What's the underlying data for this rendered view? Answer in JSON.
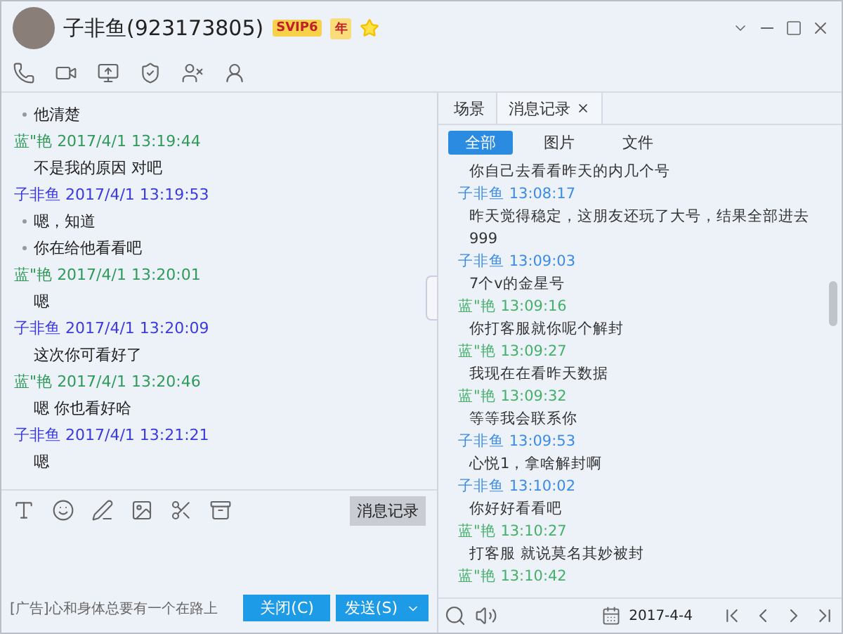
{
  "window": {
    "title": "子非鱼(923173805)",
    "badges": [
      {
        "kind": "vip",
        "label": "SVIP6"
      },
      {
        "kind": "year",
        "label": "年"
      }
    ]
  },
  "chat": [
    {
      "kind": "text",
      "text": "他清楚",
      "bullet": true
    },
    {
      "kind": "meta",
      "sender": "蓝\"艳",
      "time": "2017/4/1 13:19:44",
      "color": "#2f9a5a"
    },
    {
      "kind": "text",
      "text": "不是我的原因 对吧",
      "bullet": false
    },
    {
      "kind": "meta",
      "sender": "子非鱼",
      "time": "2017/4/1 13:19:53",
      "color": "#3a3ae0"
    },
    {
      "kind": "text",
      "text": "嗯，知道",
      "bullet": true
    },
    {
      "kind": "text",
      "text": "你在给他看看吧",
      "bullet": true
    },
    {
      "kind": "meta",
      "sender": "蓝\"艳",
      "time": "2017/4/1 13:20:01",
      "color": "#2f9a5a"
    },
    {
      "kind": "text",
      "text": "嗯",
      "bullet": false
    },
    {
      "kind": "meta",
      "sender": "子非鱼",
      "time": "2017/4/1 13:20:09",
      "color": "#3a3ae0"
    },
    {
      "kind": "text",
      "text": "这次你可看好了",
      "bullet": false
    },
    {
      "kind": "meta",
      "sender": "蓝\"艳",
      "time": "2017/4/1 13:20:46",
      "color": "#2f9a5a"
    },
    {
      "kind": "text",
      "text": "嗯 你也看好哈",
      "bullet": false
    },
    {
      "kind": "meta",
      "sender": "子非鱼",
      "time": "2017/4/1 13:21:21",
      "color": "#3a3ae0"
    },
    {
      "kind": "text",
      "text": "嗯",
      "bullet": false
    }
  ],
  "input": {
    "history_button": "消息记录",
    "ad": "[广告]心和身体总要有一个在路上",
    "buttons": [
      "关闭(C)",
      "发送(S)"
    ]
  },
  "history": {
    "tabs": [
      {
        "label": "场景",
        "selected": false
      },
      {
        "label": "消息记录",
        "selected": true
      }
    ],
    "filters": [
      {
        "label": "全部",
        "selected": true
      },
      {
        "label": "图片",
        "selected": false
      },
      {
        "label": "文件",
        "selected": false
      }
    ],
    "messages": [
      {
        "kind": "text",
        "text": "你自己去看看昨天的内几个号"
      },
      {
        "kind": "meta",
        "sender": "子非鱼",
        "time": "13:08:17",
        "color": "#3c8ce6"
      },
      {
        "kind": "text",
        "text": "昨天觉得稳定，这朋友还玩了大号，结果全部进去999"
      },
      {
        "kind": "meta",
        "sender": "子非鱼",
        "time": "13:09:03",
        "color": "#3c8ce6"
      },
      {
        "kind": "text",
        "text": "7个v的金星号"
      },
      {
        "kind": "meta",
        "sender": "蓝\"艳",
        "time": "13:09:16",
        "color": "#45b06a"
      },
      {
        "kind": "text",
        "text": "你打客服就你呢个解封"
      },
      {
        "kind": "meta",
        "sender": "蓝\"艳",
        "time": "13:09:27",
        "color": "#45b06a"
      },
      {
        "kind": "text",
        "text": "我现在在看昨天数据"
      },
      {
        "kind": "meta",
        "sender": "蓝\"艳",
        "time": "13:09:32",
        "color": "#45b06a"
      },
      {
        "kind": "text",
        "text": "等等我会联系你"
      },
      {
        "kind": "meta",
        "sender": "子非鱼",
        "time": "13:09:53",
        "color": "#3c8ce6"
      },
      {
        "kind": "text",
        "text": "心悦1，拿啥解封啊"
      },
      {
        "kind": "meta",
        "sender": "子非鱼",
        "time": "13:10:02",
        "color": "#3c8ce6"
      },
      {
        "kind": "text",
        "text": "你好好看看吧"
      },
      {
        "kind": "meta",
        "sender": "蓝\"艳",
        "time": "13:10:27",
        "color": "#45b06a"
      },
      {
        "kind": "text",
        "text": "打客服 就说莫名其妙被封"
      },
      {
        "kind": "meta",
        "sender": "蓝\"艳",
        "time": "13:10:42",
        "color": "#45b06a"
      }
    ],
    "date": "2017-4-4"
  }
}
